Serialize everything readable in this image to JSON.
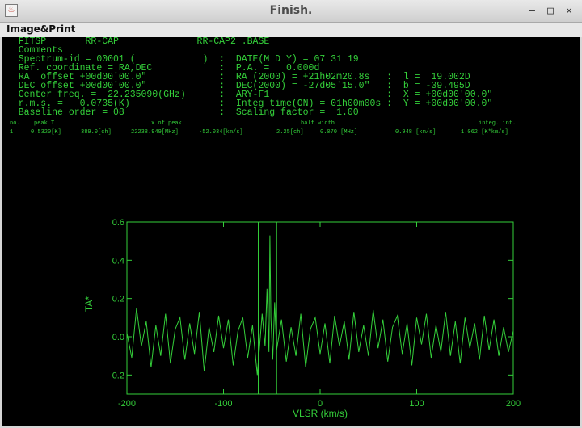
{
  "window": {
    "title": "Finish.",
    "icon": "java-icon",
    "controls": [
      "minimize-icon",
      "maximize-icon",
      "close-icon"
    ],
    "control_glyphs": [
      "–",
      "□",
      "✕"
    ]
  },
  "menu": {
    "items": [
      "Image&Print"
    ]
  },
  "colors": {
    "plot": "#34d03a",
    "background": "#000000",
    "chrome": "#d6d6d6"
  },
  "header_lines": [
    "   FITSP       RR-CAP              RR-CAP2 .BASE",
    "   Comments",
    "   Spectrum-id = 00001 (            )  :  DATE(M D Y) = 07 31 19",
    "   Ref. coordinate = RA,DEC            :  P.A. =   0.000d",
    "   RA  offset +00d00'00.0\"             :  RA (2000) = +21h02m20.8s   :  l =  19.002D",
    "   DEC offset +00d00'00.0\"             :  DEC(2000) = -27d05'15.0\"   :  b = -39.495D",
    "   Center freq. =  22.235090(GHz)      :  ARY-F1                     :  X = +00d00'00.0\"",
    "   r.m.s. =   0.0735(K)                :  Integ time(ON) = 01h00m00s :  Y = +00d00'00.0\"",
    "   Baseline order = 08                 :  Scaling factor =  1.00"
  ],
  "line_table": {
    "headers": [
      "no.",
      "peak T",
      "x of peak",
      "half width",
      "integ. int."
    ],
    "row": [
      "1",
      "0.5320[K]",
      "389.0[ch]",
      "22238.949[MHz]",
      "-52.034[km/s]",
      "2.25[ch]",
      "0.070 [MHz]",
      "0.948 [km/s]",
      "1.062 [K*km/s]"
    ]
  },
  "chart_data": {
    "type": "line",
    "xlabel": "VLSR (km/s)",
    "ylabel": "TA*",
    "xlim": [
      -200,
      200
    ],
    "ylim": [
      -0.3,
      0.6
    ],
    "x_ticks": [
      -200,
      -100,
      0,
      100,
      200
    ],
    "y_ticks": [
      -0.2,
      0.0,
      0.2,
      0.4,
      0.6
    ],
    "x_tick_labels": [
      "-200",
      "-100",
      "0",
      "100",
      "200"
    ],
    "y_tick_labels": [
      "-0.2",
      "0.0",
      "0.2",
      "0.4",
      "0.6"
    ],
    "markers_x": [
      -64,
      -45
    ],
    "series": [
      {
        "x": [
          -200,
          -195,
          -190,
          -185,
          -180,
          -175,
          -170,
          -165,
          -160,
          -155,
          -150,
          -145,
          -140,
          -135,
          -130,
          -125,
          -120,
          -115,
          -110,
          -105,
          -100,
          -95,
          -90,
          -85,
          -80,
          -75,
          -70,
          -65,
          -60,
          -57,
          -55,
          -53,
          -52,
          -51,
          -49,
          -47,
          -45,
          -40,
          -35,
          -30,
          -25,
          -20,
          -15,
          -10,
          -5,
          0,
          5,
          10,
          15,
          20,
          25,
          30,
          35,
          40,
          45,
          50,
          55,
          60,
          65,
          70,
          75,
          80,
          85,
          90,
          95,
          100,
          105,
          110,
          115,
          120,
          125,
          130,
          135,
          140,
          145,
          150,
          155,
          160,
          165,
          170,
          175,
          180,
          185,
          190,
          195,
          200
        ],
        "y": [
          0.02,
          -0.11,
          0.15,
          -0.05,
          0.08,
          -0.16,
          0.06,
          -0.1,
          0.12,
          -0.14,
          0.04,
          0.1,
          -0.12,
          0.07,
          -0.09,
          0.13,
          -0.18,
          0.05,
          -0.08,
          0.11,
          -0.06,
          0.09,
          -0.15,
          0.03,
          0.1,
          -0.11,
          0.06,
          -0.2,
          0.12,
          -0.05,
          0.25,
          -0.08,
          0.53,
          0.1,
          -0.12,
          0.18,
          -0.07,
          0.09,
          -0.13,
          0.05,
          -0.1,
          0.12,
          -0.16,
          0.04,
          0.1,
          -0.09,
          0.07,
          -0.14,
          0.11,
          -0.05,
          0.08,
          -0.12,
          0.13,
          -0.08,
          0.06,
          -0.1,
          0.14,
          -0.06,
          0.09,
          -0.13,
          0.05,
          0.11,
          -0.09,
          0.07,
          -0.15,
          0.1,
          -0.04,
          0.12,
          -0.11,
          0.06,
          -0.08,
          0.13,
          -0.1,
          0.08,
          -0.14,
          0.1,
          -0.06,
          0.07,
          -0.12,
          0.11,
          -0.07,
          0.09,
          -0.1,
          0.05,
          -0.08,
          0.03
        ]
      }
    ]
  }
}
